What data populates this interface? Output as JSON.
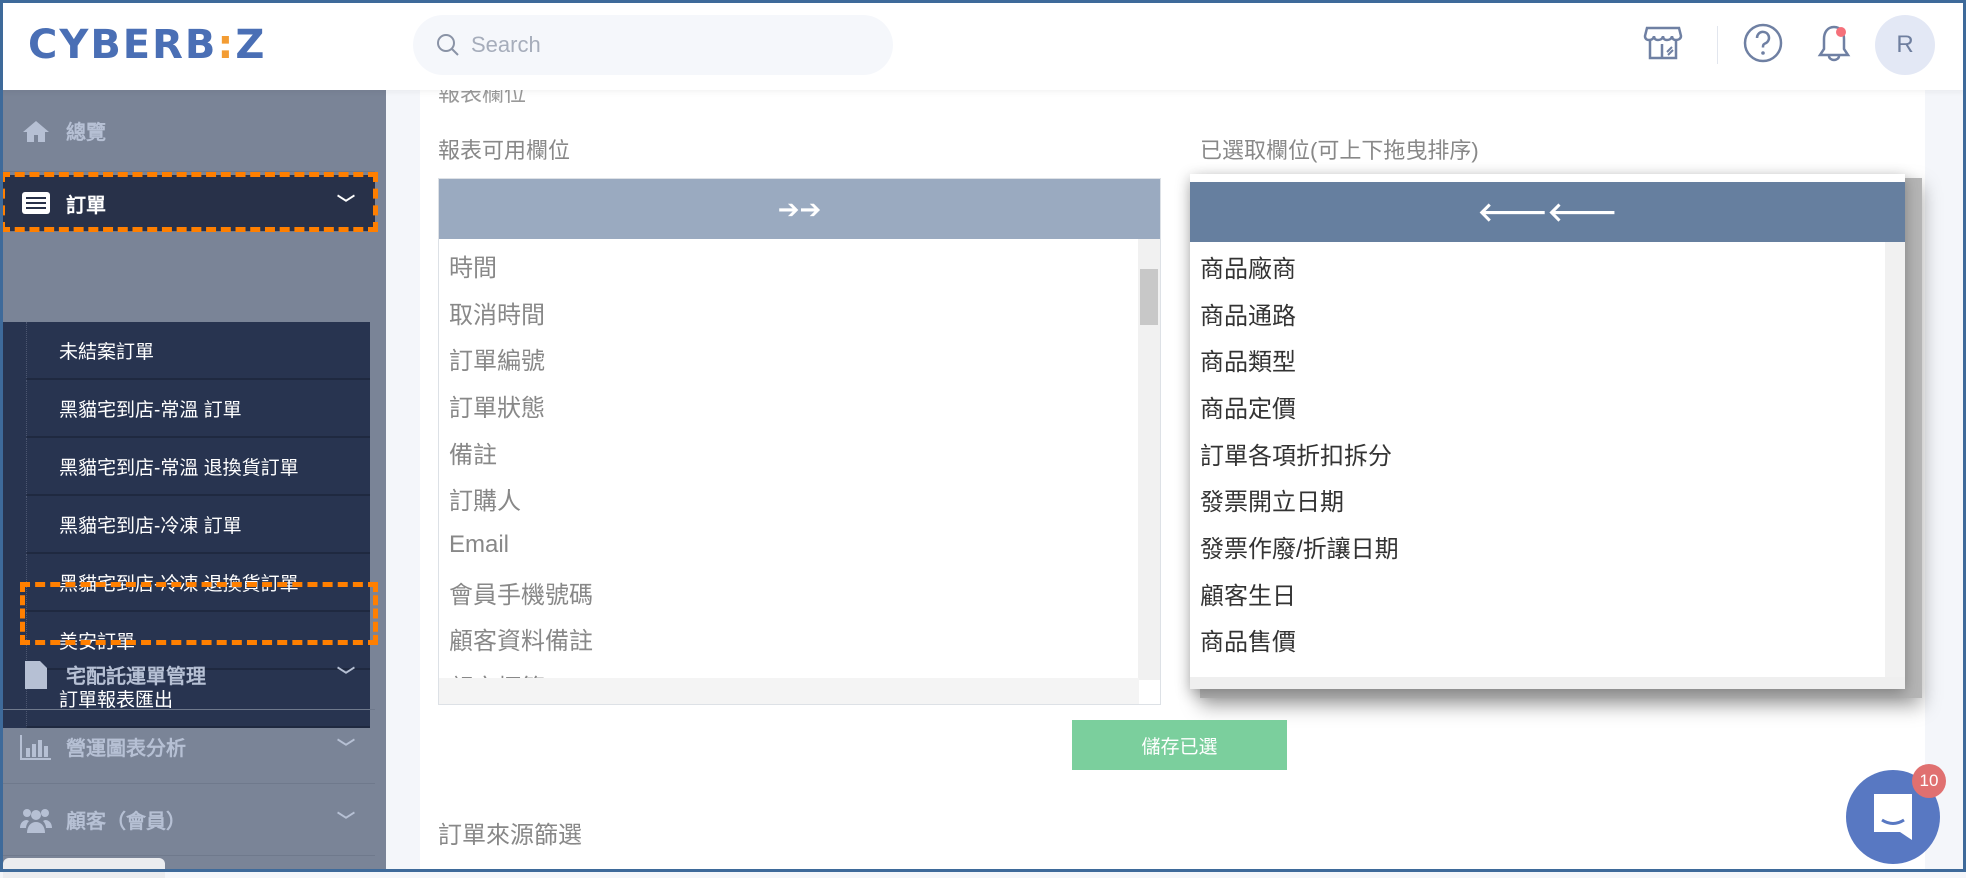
{
  "header": {
    "logo": "CYBERBIZ",
    "search_placeholder": "Search",
    "avatar_initial": "R",
    "icons": [
      "store-icon",
      "help-icon",
      "bell-icon"
    ],
    "notification_dot_color": "#f5707a"
  },
  "sidebar": {
    "items": [
      {
        "label": "總覽",
        "icon": "home-icon"
      },
      {
        "label": "訂單",
        "icon": "list-icon",
        "active": true
      },
      {
        "label": "宅配託運單管理",
        "icon": "file-icon"
      },
      {
        "label": "營運圖表分析",
        "icon": "bar-chart-icon"
      },
      {
        "label": "顧客（會員）",
        "icon": "users-icon"
      }
    ],
    "order_submenu": [
      "未結案訂單",
      "黑貓宅到店-常溫 訂單",
      "黑貓宅到店-常溫 退換貨訂單",
      "黑貓宅到店-冷凍 訂單",
      "黑貓宅到店-冷凍 退換貨訂單",
      "美安訂單",
      "訂單報表匯出"
    ],
    "highlight_color": "#ff7f00"
  },
  "main": {
    "section_title": "報表欄位",
    "available_label": "報表可用欄位",
    "selected_label": "已選取欄位(可上下拖曳排序)",
    "add_all_symbol": "➔➔",
    "remove_all_symbol": "🡐🡐",
    "available_fields": [
      "時間",
      "取消時間",
      "訂單編號",
      "訂單狀態",
      "備註",
      "訂購人",
      "Email",
      "會員手機號碼",
      "顧客資料備註",
      "顧客標籤"
    ],
    "selected_fields": [
      "商品廠商",
      "商品通路",
      "商品類型",
      "商品定價",
      "訂單各項折扣拆分",
      "發票開立日期",
      "發票作廢/折讓日期",
      "顧客生日",
      "商品售價"
    ],
    "save_button": "儲存已選",
    "source_filter_title": "訂單來源篩選",
    "colors": {
      "available_header": "#9aaac0",
      "selected_header": "#667f9f",
      "save": "#7bcf9d"
    }
  },
  "chat": {
    "badge_count": "10",
    "color": "#5878c2"
  }
}
